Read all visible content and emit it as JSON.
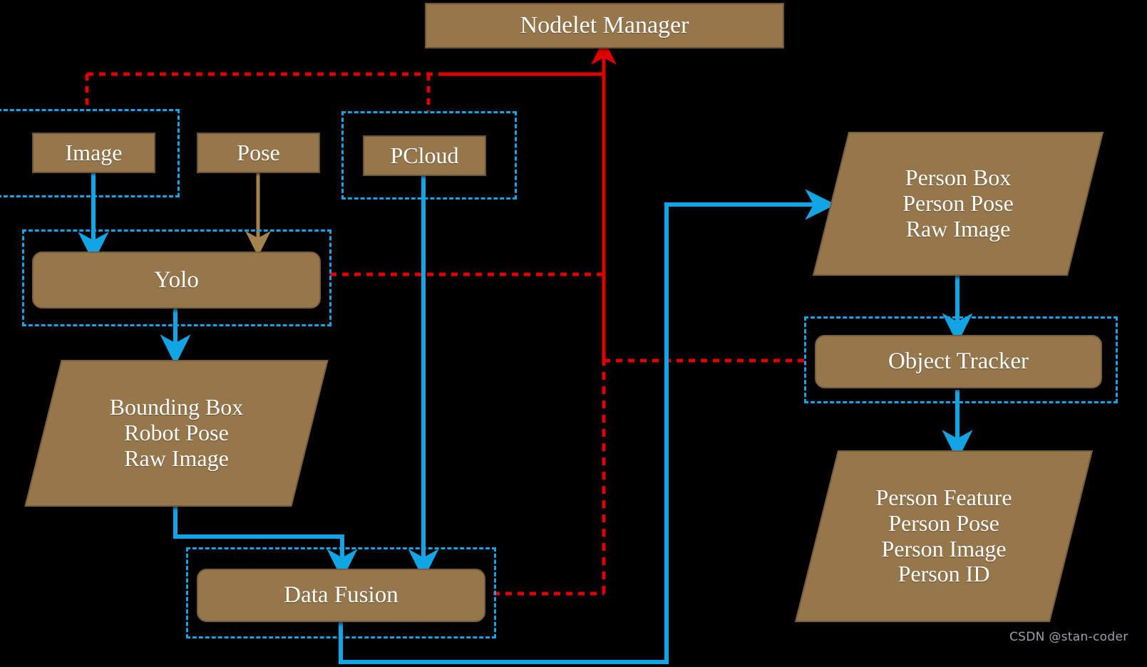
{
  "diagram": {
    "title": "Nodelet Manager pipeline",
    "background_color": "#000000",
    "palette": {
      "node_fill": "#96764B",
      "node_border": "#7A5E3C",
      "group_dash": "#12A5E6",
      "flow_blue": "#12A5E6",
      "flow_brown": "#A5834F",
      "manager_red": "#E00000",
      "label_text": "#FFFFFF",
      "watermark_text": "#9AA0A6"
    }
  },
  "nodes": {
    "nodelet_manager": {
      "label": "Nodelet Manager",
      "shape": "rectangle"
    },
    "image": {
      "label": "Image",
      "shape": "rectangle"
    },
    "pose": {
      "label": "Pose",
      "shape": "rectangle"
    },
    "pcloud": {
      "label": "PCloud",
      "shape": "rectangle"
    },
    "yolo": {
      "label": "Yolo",
      "shape": "rounded-rectangle"
    },
    "data_fusion": {
      "label": "Data Fusion",
      "shape": "rounded-rectangle"
    },
    "object_tracker": {
      "label": "Object Tracker",
      "shape": "rounded-rectangle"
    },
    "bounding_box_data": {
      "label": "Bounding Box\nRobot Pose\nRaw Image",
      "shape": "parallelogram"
    },
    "person_box_data": {
      "label": "Person Box\nPerson Pose\nRaw Image",
      "shape": "parallelogram"
    },
    "person_feature_data": {
      "label": "Person Feature\nPerson Pose\nPerson Image\nPerson ID",
      "shape": "parallelogram"
    }
  },
  "groups": [
    {
      "name": "image-nodelet-group",
      "contains": "image"
    },
    {
      "name": "pcloud-nodelet-group",
      "contains": "pcloud"
    },
    {
      "name": "yolo-nodelet-group",
      "contains": "yolo"
    },
    {
      "name": "data-fusion-nodelet-group",
      "contains": "data_fusion"
    },
    {
      "name": "object-tracker-nodelet-group",
      "contains": "object_tracker"
    }
  ],
  "edges": [
    {
      "from": "image",
      "to": "yolo",
      "style": "solid",
      "color": "#12A5E6"
    },
    {
      "from": "pose",
      "to": "yolo",
      "style": "solid",
      "color": "#A5834F"
    },
    {
      "from": "pcloud",
      "to": "data_fusion",
      "style": "solid",
      "color": "#12A5E6"
    },
    {
      "from": "yolo",
      "to": "bounding_box_data",
      "style": "solid",
      "color": "#12A5E6"
    },
    {
      "from": "bounding_box_data",
      "to": "data_fusion",
      "style": "solid",
      "color": "#12A5E6"
    },
    {
      "from": "data_fusion",
      "to": "person_box_data",
      "style": "solid",
      "color": "#12A5E6"
    },
    {
      "from": "person_box_data",
      "to": "object_tracker",
      "style": "solid",
      "color": "#12A5E6"
    },
    {
      "from": "object_tracker",
      "to": "person_feature_data",
      "style": "solid",
      "color": "#12A5E6"
    },
    {
      "from": "image_group",
      "to": "nodelet_manager",
      "style": "dashed",
      "color": "#E00000"
    },
    {
      "from": "pcloud_group",
      "to": "nodelet_manager",
      "style": "dashed",
      "color": "#E00000"
    },
    {
      "from": "yolo",
      "to": "nodelet_manager",
      "style": "dashed",
      "color": "#E00000"
    },
    {
      "from": "data_fusion",
      "to": "nodelet_manager",
      "style": "dashed",
      "color": "#E00000"
    },
    {
      "from": "object_tracker",
      "to": "nodelet_manager",
      "style": "dashed",
      "color": "#E00000"
    }
  ],
  "watermark": {
    "text": "CSDN @stan-coder"
  }
}
